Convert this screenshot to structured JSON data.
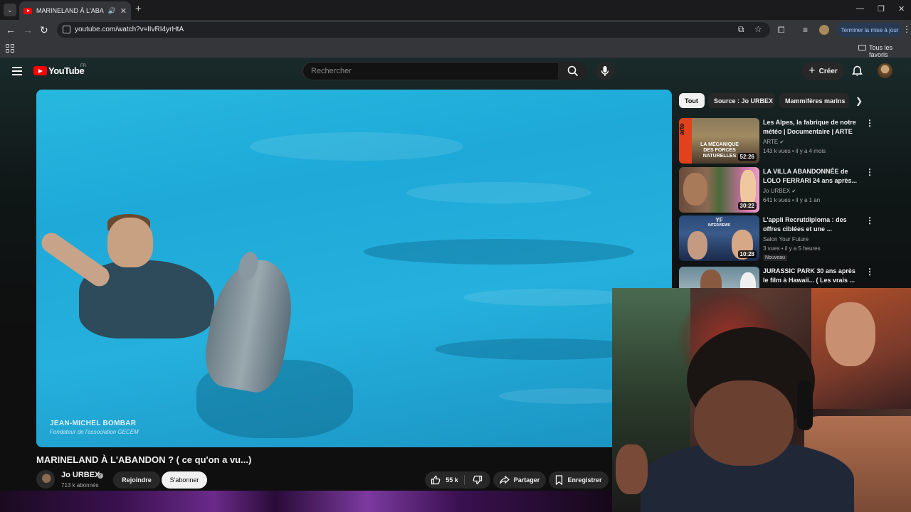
{
  "browser": {
    "tab_title": "MARINELAND À L'ABANDON",
    "url": "youtube.com/watch?v=lIvRI4yrHtA",
    "update_button": "Terminer la mise à jour",
    "bookmarks_folder": "Tous les favoris"
  },
  "header": {
    "logo": "YouTube",
    "logo_country": "FR",
    "search_placeholder": "Rechercher",
    "create_label": "Créer"
  },
  "video": {
    "caption_name": "JEAN-MICHEL BOMBAR",
    "caption_role": "Fondateur de l'association GECEM",
    "title": "MARINELAND À L'ABANDON ? ( ce qu'on a vu...)",
    "channel": "Jo URBEX",
    "subscribers": "713 k abonnés",
    "join_label": "Rejoindre",
    "subscribe_label": "S'abonner",
    "likes": "55 k",
    "share_label": "Partager",
    "save_label": "Enregistrer"
  },
  "chips": [
    "Tout",
    "Source : Jo URBEX",
    "Mammifères marins"
  ],
  "recommendations": [
    {
      "title": "Les Alpes, la fabrique de notre météo | Documentaire | ARTE",
      "channel": "ARTE",
      "meta": "143 k vues • il y a 4 mois",
      "duration": "52:26",
      "thumb_text": "LA MÉCANIQUE DES FORCES NATURELLES",
      "thumb_brand": "arte"
    },
    {
      "title": "LA VILLA ABANDONNÉE de LOLO FERRARI 24 ans après...(...",
      "channel": "Jo URBEX",
      "meta": "641 k vues • il y a 1 an",
      "duration": "30:22"
    },
    {
      "title": "L'appli Recrutdiploma : des offres ciblées et une ...",
      "channel": "Salon Your Future",
      "meta": "3 vues • il y a 5 heures",
      "duration": "10:28",
      "badge": "Nouveau",
      "thumb_text": "YF",
      "thumb_sub": "INTERVIEWS"
    },
    {
      "title": "JURASSIC PARK 30 ans après le film à Hawaii... ( Les vrais ..."
    }
  ],
  "colors": {
    "brand_red": "#ff0000",
    "page_bg": "#0f0f0f",
    "water": "#1ea9d8"
  }
}
